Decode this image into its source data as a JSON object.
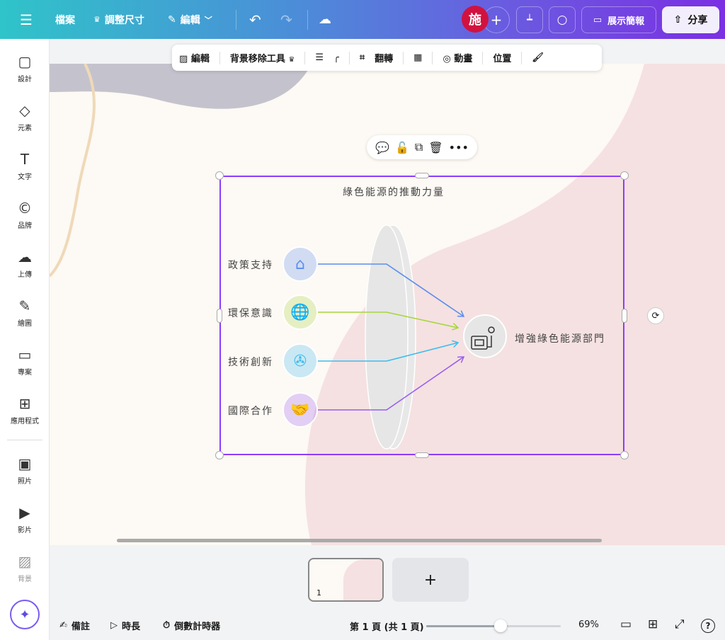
{
  "topbar": {
    "menu_icon": "hamburger-icon",
    "file": "檔案",
    "resize": "調整尺寸",
    "edit": "編輯",
    "avatar": "施",
    "present": "展示簡報",
    "share": "分享"
  },
  "toolbar": {
    "edit": "編輯",
    "bg_remover": "背景移除工具",
    "flip": "翻轉",
    "animate": "動畫",
    "position": "位置"
  },
  "sidebar": {
    "items": [
      {
        "label": "設計",
        "icon": "▢"
      },
      {
        "label": "元素",
        "icon": "◇"
      },
      {
        "label": "文字",
        "icon": "T"
      },
      {
        "label": "品牌",
        "icon": "©"
      },
      {
        "label": "上傳",
        "icon": "☁"
      },
      {
        "label": "繪圖",
        "icon": "✎"
      },
      {
        "label": "專案",
        "icon": "▭"
      },
      {
        "label": "應用程式",
        "icon": "⊞"
      },
      {
        "label": "照片",
        "icon": "▣"
      },
      {
        "label": "影片",
        "icon": "▶"
      },
      {
        "label": "背景",
        "icon": "▨"
      }
    ]
  },
  "diagram": {
    "title": "綠色能源的推動力量",
    "inputs": [
      {
        "label": "政策支持",
        "color": "#5b8def"
      },
      {
        "label": "環保意識",
        "color": "#a6d63a"
      },
      {
        "label": "技術創新",
        "color": "#3cbcf0"
      },
      {
        "label": "國際合作",
        "color": "#9a5cf0"
      }
    ],
    "output": "增強綠色能源部門"
  },
  "bottom": {
    "notes": "備註",
    "duration": "時長",
    "timer": "倒數計時器",
    "page_info": "第 1 頁 (共 1 頁)",
    "zoom": "69%",
    "zoom_fraction": 0.55,
    "page_number": "1",
    "add_page": "+"
  }
}
